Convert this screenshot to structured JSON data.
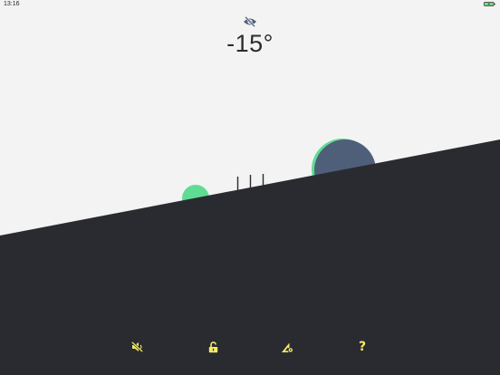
{
  "status_bar": {
    "time": "13:16",
    "battery_icon": "battery-charging-icon",
    "battery_color": "#4cd964"
  },
  "level": {
    "angle": "-15°",
    "visibility_icon": "eye-slash-icon"
  },
  "colors": {
    "upper_background": "#f3f3f3",
    "lower_background": "#2a2b30",
    "text": "#2b2c30",
    "accent_green": "#5fdc93",
    "bubble_fill": "#4f5f7a",
    "icon_yellow": "#f5ea68"
  },
  "toolbar": {
    "sound": {
      "icon": "speaker-muted-icon"
    },
    "lock": {
      "icon": "lock-open-icon"
    },
    "calibrate": {
      "icon": "triangle-ruler-gear-icon"
    },
    "help": {
      "icon": "question-icon",
      "label": "?"
    }
  }
}
